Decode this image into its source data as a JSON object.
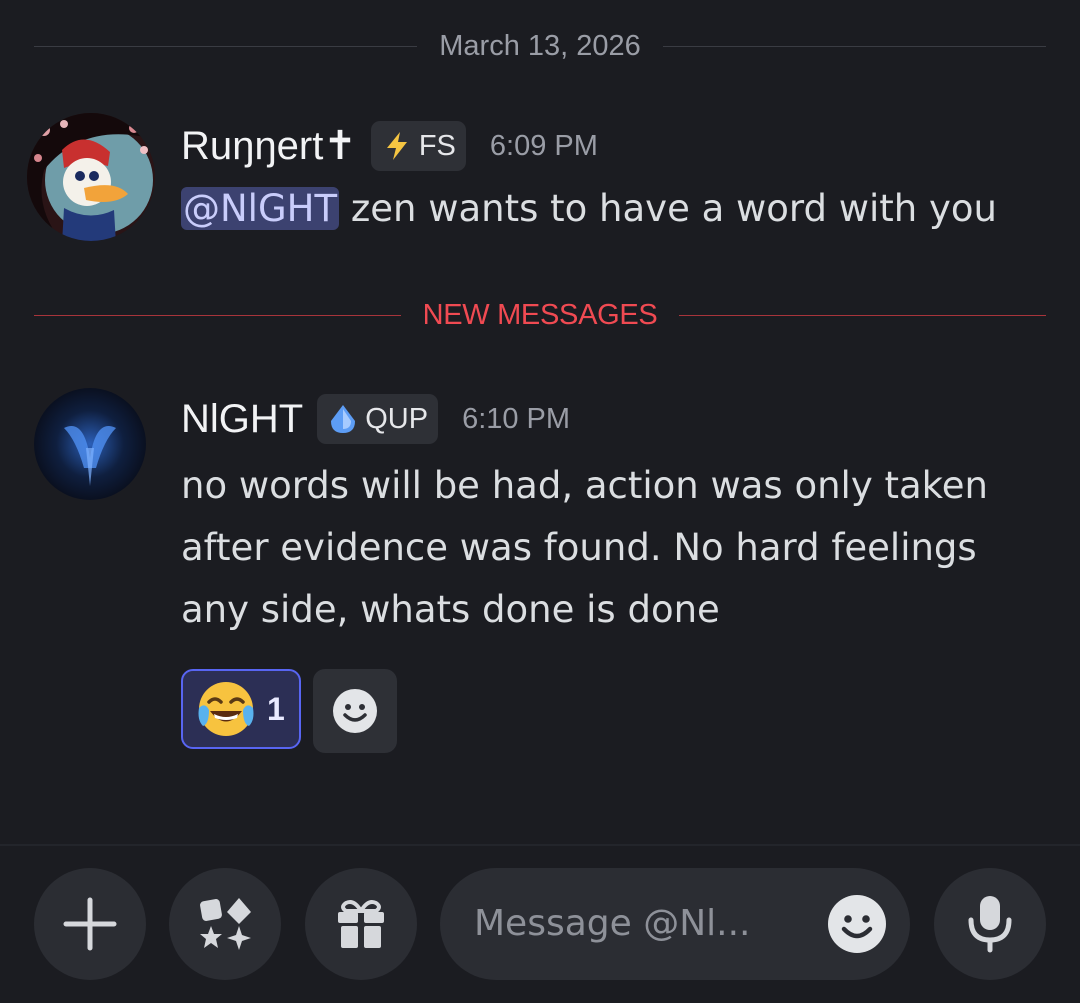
{
  "date_divider": {
    "label": "March 13, 2026"
  },
  "messages": [
    {
      "username": "Ruŋŋert✝",
      "tag": {
        "icon": "lightning-icon",
        "label": "FS",
        "color": "#f5c542"
      },
      "time": "6:09 PM",
      "mention": "@NlGHT",
      "text": " zen wants to have a word with you"
    },
    {
      "username": "NlGHT",
      "tag": {
        "icon": "diamond-drop-icon",
        "label": "QUP",
        "color": "#6aa8ff"
      },
      "time": "6:10 PM",
      "text": "no words will be had, action was only taken after evidence was found. No hard feelings any side, whats done is done",
      "reactions": [
        {
          "emoji": "😂",
          "count": "1"
        }
      ]
    }
  ],
  "new_messages_divider": {
    "label": "NEW MESSAGES"
  },
  "composer": {
    "placeholder": "Message @Nl...",
    "buttons": [
      "plus-icon",
      "apps-icon",
      "gift-icon",
      "emoji-icon",
      "microphone-icon"
    ]
  },
  "colors": {
    "background": "#1b1c21",
    "mention_bg": "#3c4270",
    "new_messages_red": "#f04a52",
    "reaction_border": "#5865f2"
  }
}
